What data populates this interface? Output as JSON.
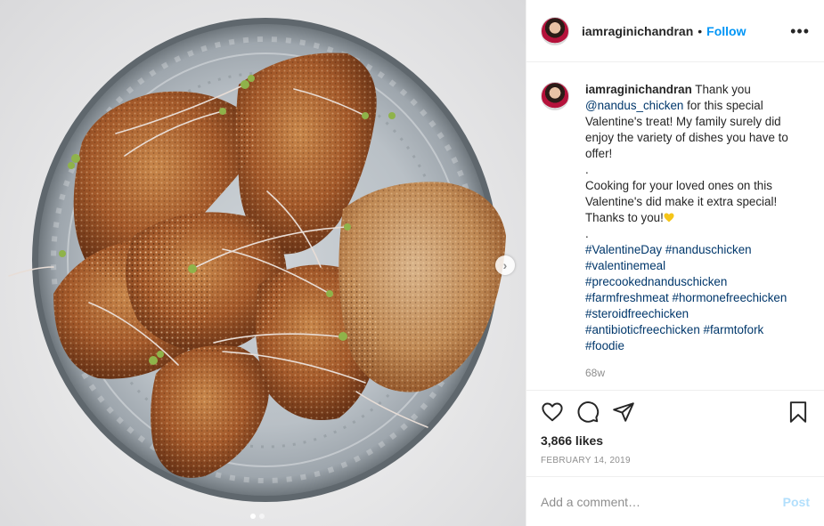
{
  "post": {
    "username": "iamraginichandran",
    "follow_label": "Follow",
    "separator": "•",
    "more_label": "•••",
    "image_alt": "Fried breaded chicken pieces with microgreens on a cut-glass plate",
    "carousel": {
      "count": 2,
      "active": 0,
      "next_label": "›"
    }
  },
  "caption": {
    "username": "iamraginichandran",
    "text_start": "Thank you",
    "mention": "@nandus_chicken",
    "text_after_mention": "for this special Valentine's treat! My family surely did enjoy the variety of dishes you have to offer!",
    "dot1": ".",
    "paragraph2": "Cooking for your loved ones on this Valentine's did make it extra special! Thanks to you!",
    "dot2": ".",
    "hashtags": [
      "#ValentineDay",
      "#nanduschicken",
      "#valentinemeal",
      "#precookednanduschicken",
      "#farmfreshmeat",
      "#hormonefreechicken",
      "#steroidfreechicken",
      "#antibioticfreechicken",
      "#farmtofork",
      "#foodie"
    ],
    "time_ago": "68w"
  },
  "engagement": {
    "likes": "3,866 likes",
    "date": "FEBRUARY 14, 2019",
    "icons": [
      "heart-icon",
      "comment-icon",
      "share-icon",
      "bookmark-icon"
    ]
  },
  "comment_box": {
    "placeholder": "Add a comment…",
    "post_label": "Post"
  },
  "colors": {
    "link_blue": "#0095f6",
    "hashtag_blue": "#00376b",
    "muted": "#8e8e8e",
    "post_disabled": "#b2dffc",
    "heart_emoji": "#f5c518"
  }
}
